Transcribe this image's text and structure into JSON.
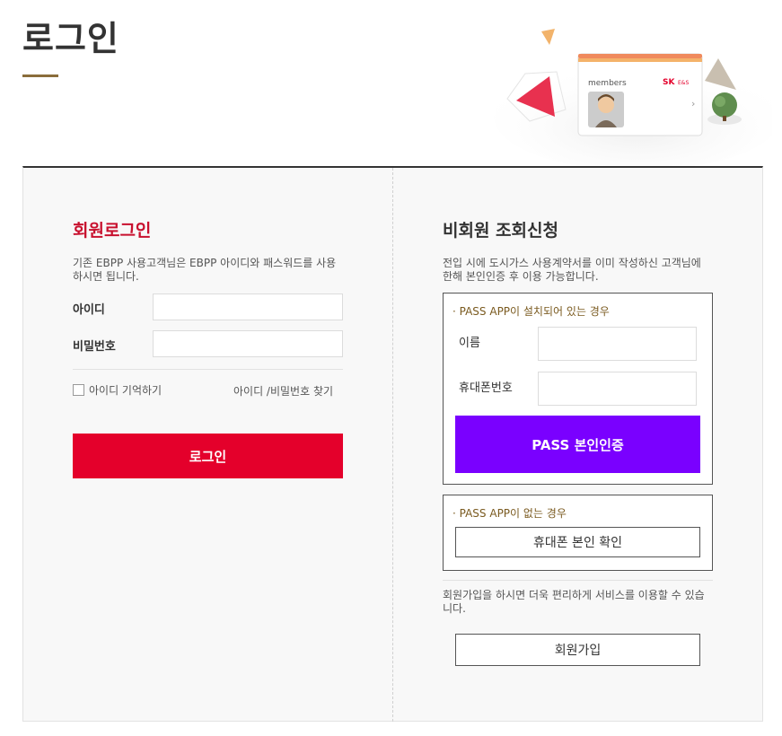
{
  "page": {
    "title": "로그인"
  },
  "hero": {
    "card_label": "members",
    "brand_sk": "SK",
    "brand_es": "E&S"
  },
  "member_login": {
    "title": "회원로그인",
    "description": "기존 EBPP 사용고객님은 EBPP 아이디와 패스워드를 사용하시면 됩니다.",
    "id_label": "아이디",
    "id_value": "",
    "password_label": "비밀번호",
    "password_value": "",
    "remember_label": "아이디 기억하기",
    "find_link": "아이디 /비밀번호 찾기",
    "login_button": "로그인"
  },
  "guest": {
    "title": "비회원 조회신청",
    "description": "전입 시에 도시가스 사용계약서를 이미 작성하신 고객님에 한해 본인인증 후 이용 가능합니다.",
    "pass_installed": {
      "heading": "· PASS APP이 설치되어 있는 경우",
      "name_label": "이름",
      "name_value": "",
      "phone_label": "휴대폰번호",
      "phone_value": "",
      "button": "PASS 본인인증"
    },
    "pass_not_installed": {
      "heading": "· PASS APP이 없는 경우",
      "button": "휴대폰 본인 확인"
    },
    "join_description": "회원가입을 하시면 더욱 편리하게 서비스를 이용할 수 있습니다.",
    "join_button": "회원가입"
  },
  "colors": {
    "login_red": "#e4002b",
    "title_red": "#c8102e",
    "pass_purple": "#7a00ff",
    "gold": "#8a6d3b"
  }
}
